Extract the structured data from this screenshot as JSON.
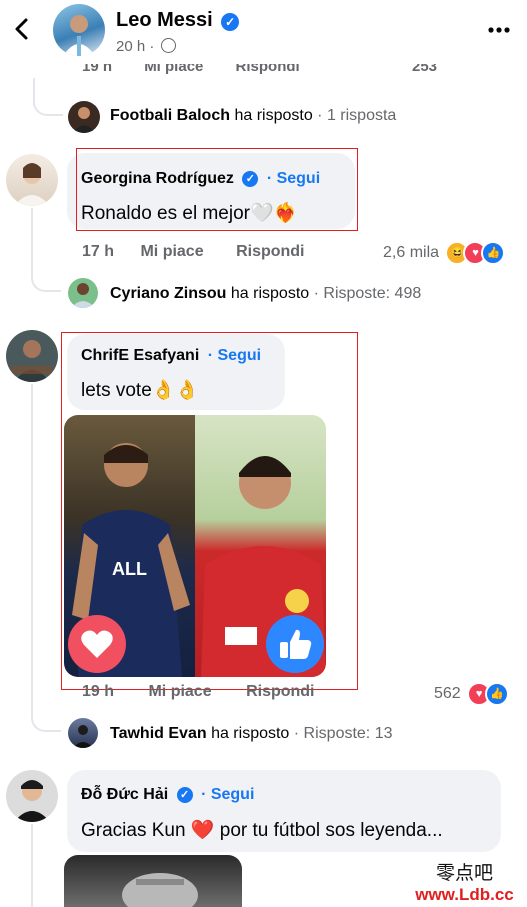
{
  "header": {
    "title": "Leo Messi",
    "subtitle": "20 h ·",
    "back_icon": "chevron-left-icon",
    "more_icon": "more-icon"
  },
  "top_meta": {
    "time": "19 h",
    "like": "Mi piace",
    "reply": "Rispondi",
    "count": "253"
  },
  "reply1": {
    "who": "Footbali Baloch",
    "text": "ha risposto",
    "count": "· 1 risposta"
  },
  "comment1": {
    "author": "Georgina Rodríguez",
    "follow": "· Segui",
    "text": "Ronaldo es el mejor🤍❤️‍🔥",
    "time": "17 h",
    "like": "Mi piace",
    "reply": "Rispondi",
    "count": "2,6 mila"
  },
  "reply2": {
    "who": "Cyriano Zinsou",
    "text": "ha risposto",
    "count": "· Risposte: 498"
  },
  "comment2": {
    "author": "ChrifE Esafyani",
    "follow": "· Segui",
    "text": "lets vote👌👌",
    "time": "19 h",
    "like": "Mi piace",
    "reply": "Rispondi",
    "count": "562"
  },
  "reply3": {
    "who": "Tawhid Evan",
    "text": "ha risposto",
    "count": "· Risposte: 13"
  },
  "comment3": {
    "author": "Đỗ Đức Hải",
    "follow": "· Segui",
    "text": "Gracias Kun ❤️ por tu fútbol sos leyenda..."
  },
  "watermark": {
    "line1": "零点吧",
    "line2": "www.Ldb.cc"
  },
  "colors": {
    "accent": "#1877f2",
    "highlight": "#e02020",
    "love": "#f33e58"
  }
}
